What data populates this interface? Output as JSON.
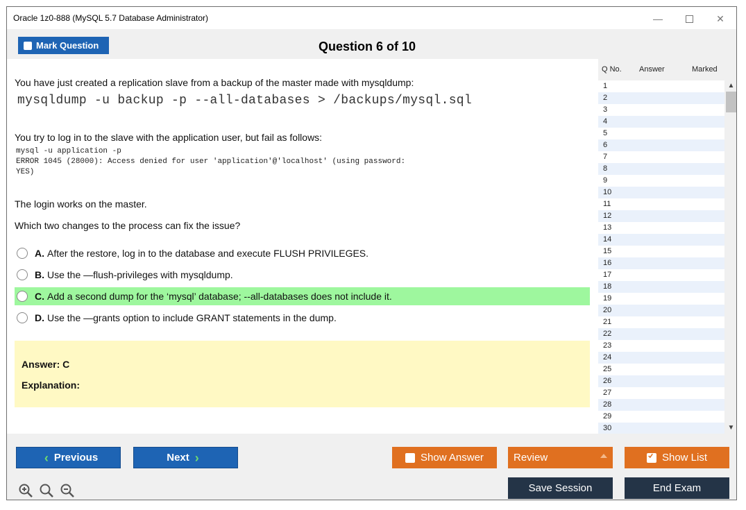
{
  "window": {
    "title": "Oracle 1z0-888 (MySQL 5.7 Database Administrator)",
    "minimize": "—",
    "close": "✕"
  },
  "header": {
    "mark_label": "Mark Question",
    "question_title": "Question 6 of 10"
  },
  "question": {
    "intro": "You have just created a replication slave from a backup of the master made with mysqldump:",
    "command": "mysqldump -u backup -p --all-databases > /backups/mysql.sql",
    "failure_text": "You try to log in to the slave with the application user, but fail as follows:",
    "error_block": "mysql -u application -p\nERROR 1045 (28000): Access denied for user 'application'@'localhost' (using password:\nYES)",
    "master_text": "The login works on the master.",
    "prompt": "Which two changes to the process can fix the issue?",
    "options": [
      {
        "letter": "A.",
        "text": "After the restore, log in to the database and execute FLUSH PRIVILEGES."
      },
      {
        "letter": "B.",
        "text": "Use the —flush-privileges with mysqldump."
      },
      {
        "letter": "C.",
        "text": "Add a second dump for the ‘mysql’ database; --all-databases does not include it."
      },
      {
        "letter": "D.",
        "text": "Use the —grants option to include GRANT statements in the dump."
      }
    ],
    "selected_option": "C"
  },
  "answer": {
    "answer_text": "Answer: C",
    "explanation_label": "Explanation:"
  },
  "question_list": {
    "headers": {
      "qno": "Q No.",
      "answer": "Answer",
      "marked": "Marked"
    },
    "rows": [
      "1",
      "2",
      "3",
      "4",
      "5",
      "6",
      "7",
      "8",
      "9",
      "10",
      "11",
      "12",
      "13",
      "14",
      "15",
      "16",
      "17",
      "18",
      "19",
      "20",
      "21",
      "22",
      "23",
      "24",
      "25",
      "26",
      "27",
      "28",
      "29",
      "30"
    ],
    "scroll_up": "▲",
    "scroll_down": "▼"
  },
  "footer": {
    "previous": "Previous",
    "next": "Next",
    "show_answer": "Show Answer",
    "review": "Review",
    "show_list": "Show List",
    "save_session": "Save Session",
    "end_exam": "End Exam",
    "zoom_icons": [
      "zoom-in-icon",
      "zoom-reset-icon",
      "zoom-out-icon"
    ]
  },
  "colors": {
    "blue": "#1e64b4",
    "orange": "#e07020",
    "dark": "#243447",
    "selected_option": "#9ef79e",
    "answer_box": "#fff9c4"
  }
}
